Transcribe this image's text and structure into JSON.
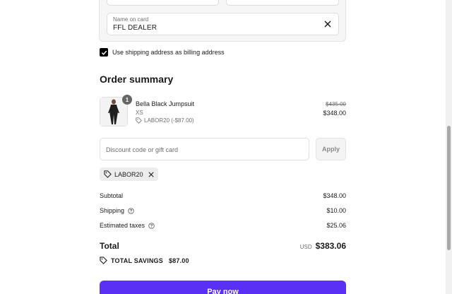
{
  "payment": {
    "name_label": "Name on card",
    "name_value": "FFL DEALER"
  },
  "billing": {
    "checkbox_label": "Use shipping address as billing address",
    "checked": true
  },
  "order_summary": {
    "title": "Order summary",
    "item": {
      "quantity": "1",
      "name": "Bella Black Jumpsuit",
      "variant": "XS",
      "discount": "LABOR20 (-$87.00)",
      "original_price": "$435.00",
      "price": "$348.00"
    },
    "discount_placeholder": "Discount code or gift card",
    "apply_label": "Apply",
    "applied_code": "LABOR20",
    "subtotal_label": "Subtotal",
    "subtotal_value": "$348.00",
    "shipping_label": "Shipping",
    "shipping_value": "$10.00",
    "taxes_label": "Estimated taxes",
    "taxes_value": "$25.06",
    "total_label": "Total",
    "currency": "USD",
    "total_value": "$383.06",
    "savings_label": "TOTAL SAVINGS",
    "savings_value": "$87.00",
    "pay_label": "Pay now"
  },
  "icons": {
    "clear": "close-icon",
    "tag": "tag-icon",
    "help": "help-circle-icon"
  },
  "colors": {
    "pay_button": "#5a31f4"
  }
}
